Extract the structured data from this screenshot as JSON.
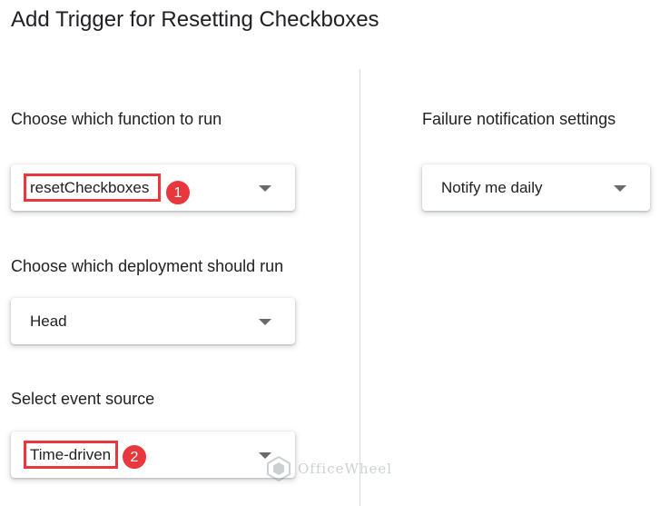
{
  "page": {
    "title": "Add Trigger for Resetting Checkboxes"
  },
  "left": {
    "function": {
      "label": "Choose which function to run",
      "value": "resetCheckboxes",
      "step": "1"
    },
    "deployment": {
      "label": "Choose which deployment should run",
      "value": "Head"
    },
    "event_source": {
      "label": "Select event source",
      "value": "Time-driven",
      "step": "2"
    }
  },
  "right": {
    "failure": {
      "label": "Failure notification settings",
      "value": "Notify me daily"
    }
  },
  "watermark": {
    "text": "OfficeWheel"
  },
  "colors": {
    "highlight": "#e8383d",
    "divider": "#dadce0",
    "caret": "#6a6a6a"
  }
}
